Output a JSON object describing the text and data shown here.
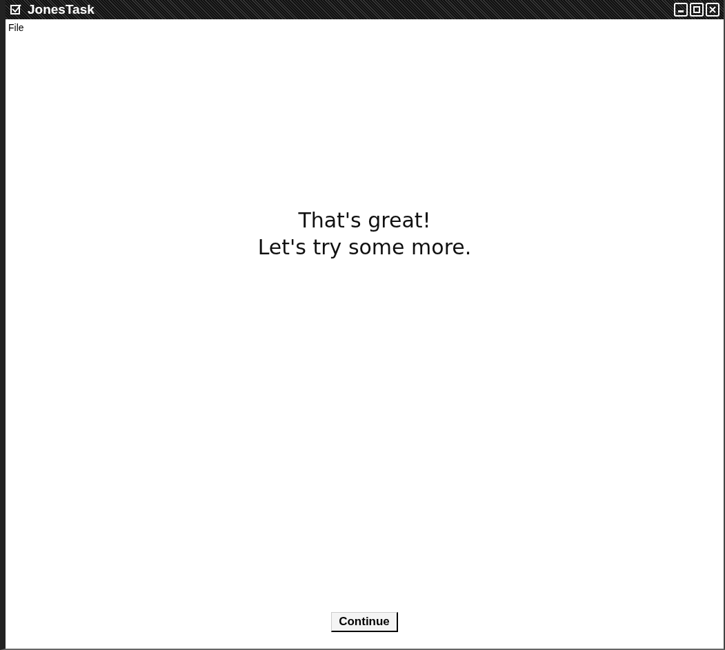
{
  "window": {
    "title": "JonesTask"
  },
  "menu": [
    "File"
  ],
  "message": [
    "That's great!",
    "Let's try some more."
  ],
  "button": {
    "label": "Continue"
  }
}
